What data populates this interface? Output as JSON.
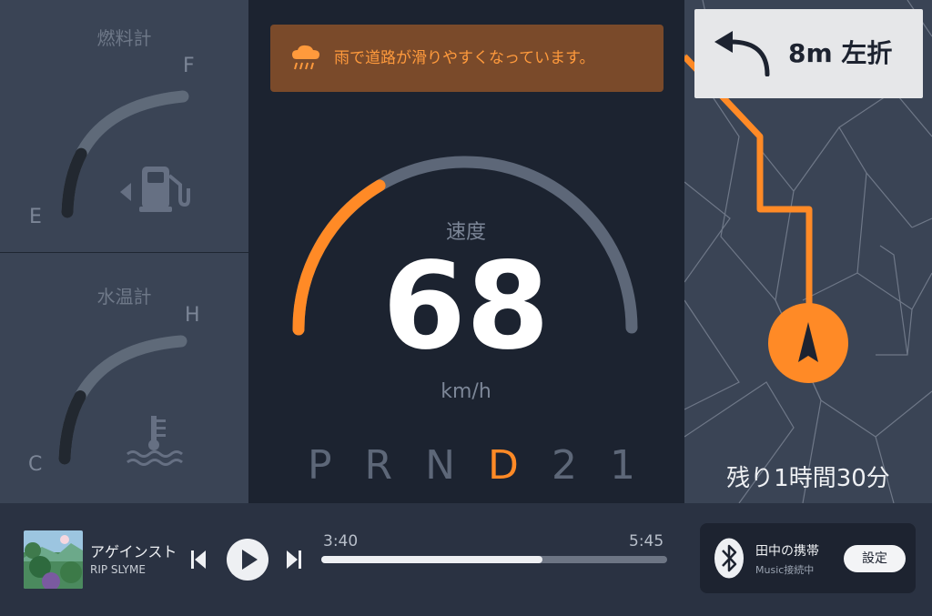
{
  "fuel_gauge": {
    "title": "燃料計",
    "full_label": "F",
    "empty_label": "E",
    "level": 0.33,
    "icon": "fuel-pump-icon"
  },
  "temp_gauge": {
    "title": "水温計",
    "high_label": "H",
    "cold_label": "C",
    "level": 0.35,
    "icon": "coolant-temperature-icon"
  },
  "warning": {
    "icon": "rain-cloud-icon",
    "text": "雨で道路が滑りやすくなっています。",
    "color": "#ff9a3c"
  },
  "speedometer": {
    "label": "速度",
    "value": "68",
    "unit": "km/h",
    "level": 0.33,
    "accent": "#ff8a26"
  },
  "gears": {
    "items": [
      "P",
      "R",
      "N",
      "D",
      "2",
      "1"
    ],
    "active": "D"
  },
  "navigation": {
    "turn_icon": "turn-left-arrow-icon",
    "instruction": "8m 左折",
    "remaining": "残り1時間30分",
    "route_color": "#ff8a26"
  },
  "media": {
    "song": "アゲインスト",
    "artist": "RIP SLYME",
    "elapsed": "3:40",
    "duration": "5:45",
    "progress": 0.64,
    "controls": [
      "previous-track-icon",
      "play-icon",
      "next-track-icon"
    ]
  },
  "bluetooth": {
    "icon": "bluetooth-icon",
    "device": "田中の携帯",
    "status": "Music接続中",
    "settings_label": "設定"
  }
}
